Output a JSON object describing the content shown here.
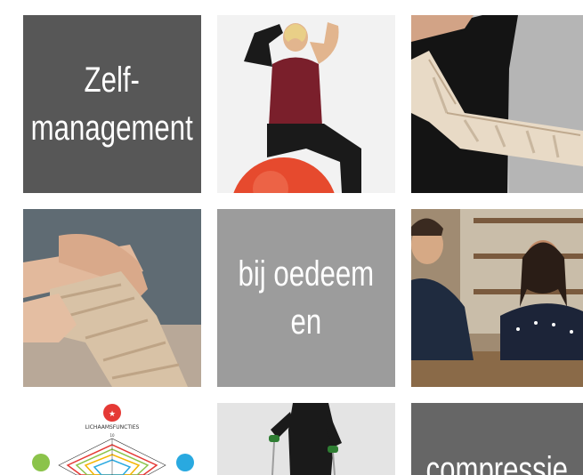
{
  "tiles": {
    "zelf_management": {
      "line1": "Zelf-",
      "line2": "management",
      "color": "#575757"
    },
    "oedeem": {
      "line1": "bij oedeem",
      "line2": "en",
      "color": "#9c9c9c"
    },
    "compressie": {
      "line1": "compressie",
      "color": "#666666"
    }
  },
  "diagram": {
    "title": "LICHAAMSFUNCTIES",
    "top_value": "10",
    "accent_colors": [
      "#e53935",
      "#8bc34a",
      "#29a9e0",
      "#f5b400"
    ]
  },
  "photos": [
    {
      "icon": "woman-exercise-ball-photo"
    },
    {
      "icon": "arm-compression-bandage-photo"
    },
    {
      "icon": "leg-bandaging-photo"
    },
    {
      "icon": "consultation-meeting-photo"
    },
    {
      "icon": "woman-walking-aid-photo"
    }
  ]
}
